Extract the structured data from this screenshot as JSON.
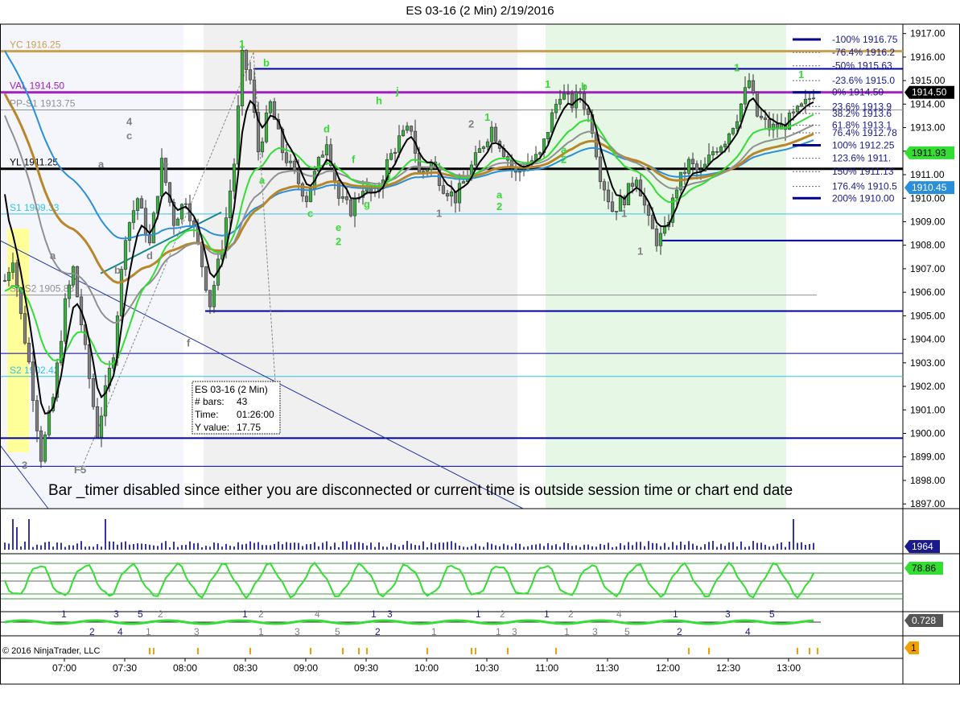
{
  "window": {
    "title": "ES 03-16 (2 Min)  2/19/2016"
  },
  "colors": {
    "up_bar": "#3cb043",
    "down_bar": "#808080",
    "ema_fast": "#000000",
    "ema_green": "#33dd33",
    "sma_brown": "#b8862b",
    "sma_blue": "#2a8fd8",
    "sma_gray": "#909090",
    "level_blue": "#0000a0",
    "level_cyan": "#33c4e6",
    "level_purple": "#a020c0",
    "level_gold": "#c8a050",
    "session_gray": "#f0f0f0",
    "session_green": "#e6f7e6",
    "opening_yellow": "#ffff99"
  },
  "chart_data": {
    "type": "candlestick",
    "instrument": "ES 03-16",
    "interval": "2 Min",
    "date": "2/19/2016",
    "y_range": [
      1896.8,
      1917.4
    ],
    "y_ticks": [
      "1917.00",
      "1916.00",
      "1915.00",
      "1914.00",
      "1913.00",
      "1912.00",
      "1911.00",
      "1910.00",
      "1909.00",
      "1908.00",
      "1907.00",
      "1906.00",
      "1905.00",
      "1904.00",
      "1903.00",
      "1902.00",
      "1901.00",
      "1900.00",
      "1899.00",
      "1898.00",
      "1897.00"
    ],
    "x_ticks": [
      "07:00",
      "07:30",
      "08:00",
      "08:30",
      "09:00",
      "09:30",
      "10:00",
      "10:30",
      "11:00",
      "11:30",
      "12:00",
      "12:30",
      "13:00"
    ],
    "price_path": [
      [
        0,
        1906.5
      ],
      [
        2,
        1907.5
      ],
      [
        4,
        1905.0
      ],
      [
        6,
        1903.0
      ],
      [
        9,
        1899.0
      ],
      [
        12,
        1901.5
      ],
      [
        15,
        1905.5
      ],
      [
        17,
        1907.0
      ],
      [
        20,
        1903.5
      ],
      [
        23,
        1900.0
      ],
      [
        27,
        1903.5
      ],
      [
        30,
        1908.5
      ],
      [
        33,
        1910.0
      ],
      [
        36,
        1908.0
      ],
      [
        39,
        1911.5
      ],
      [
        42,
        1909.0
      ],
      [
        45,
        1910.0
      ],
      [
        48,
        1908.0
      ],
      [
        51,
        1905.5
      ],
      [
        54,
        1908.0
      ],
      [
        57,
        1911.5
      ],
      [
        59,
        1916.0
      ],
      [
        61,
        1915.0
      ],
      [
        63,
        1912.0
      ],
      [
        66,
        1914.0
      ],
      [
        69,
        1912.0
      ],
      [
        72,
        1911.0
      ],
      [
        75,
        1910.0
      ],
      [
        78,
        1911.5
      ],
      [
        80,
        1912.5
      ],
      [
        83,
        1910.0
      ],
      [
        86,
        1909.5
      ],
      [
        89,
        1910.5
      ],
      [
        92,
        1910.0
      ],
      [
        95,
        1911.5
      ],
      [
        98,
        1912.5
      ],
      [
        101,
        1913.0
      ],
      [
        103,
        1911.0
      ],
      [
        106,
        1911.5
      ],
      [
        109,
        1910.5
      ],
      [
        112,
        1910.0
      ],
      [
        115,
        1911.0
      ],
      [
        118,
        1912.0
      ],
      [
        121,
        1913.0
      ],
      [
        124,
        1912.0
      ],
      [
        127,
        1911.0
      ],
      [
        130,
        1911.5
      ],
      [
        133,
        1911.8
      ],
      [
        136,
        1913.5
      ],
      [
        138,
        1914.5
      ],
      [
        141,
        1914.0
      ],
      [
        143,
        1914.5
      ],
      [
        146,
        1913.0
      ],
      [
        148,
        1911.0
      ],
      [
        151,
        1909.5
      ],
      [
        154,
        1910.0
      ],
      [
        157,
        1911.0
      ],
      [
        160,
        1909.0
      ],
      [
        162,
        1908.2
      ],
      [
        164,
        1908.5
      ],
      [
        167,
        1910.5
      ],
      [
        170,
        1911.5
      ],
      [
        173,
        1911.0
      ],
      [
        176,
        1912.0
      ],
      [
        179,
        1912.5
      ],
      [
        182,
        1913.5
      ],
      [
        185,
        1915.0
      ],
      [
        187,
        1913.5
      ],
      [
        190,
        1913.0
      ],
      [
        193,
        1913.0
      ],
      [
        196,
        1913.5
      ],
      [
        199,
        1914.0
      ],
      [
        201,
        1914.5
      ]
    ],
    "levels": [
      {
        "label": "YC 1916.25",
        "price": 1916.25,
        "color": "#c8a050"
      },
      {
        "label": "VAL 1914.50",
        "price": 1914.5,
        "color": "#a020c0"
      },
      {
        "label": "PP-S1 1913.75",
        "price": 1913.75,
        "color": "#909090"
      },
      {
        "label": "YL 1911.25",
        "price": 1911.25,
        "color": "#000000"
      },
      {
        "label": "S1 1909.33",
        "price": 1909.33,
        "color": "#33c4e6"
      },
      {
        "label": "S1-S2 1905.88",
        "price": 1905.88,
        "color": "#909090"
      },
      {
        "label": "S2 1902.42",
        "price": 1902.42,
        "color": "#33c4e6"
      }
    ],
    "horizontal_lines": [
      1915.5,
      1905.2,
      1903.4,
      1899.8,
      1898.6,
      1908.2
    ],
    "fib_levels": [
      {
        "label": "-100%",
        "value": "1916.75",
        "price": 1916.75
      },
      {
        "label": "-76.4%",
        "value": "1916.2",
        "price": 1916.2
      },
      {
        "label": "-50%",
        "value": "1915.63",
        "price": 1915.63
      },
      {
        "label": "-23.6%",
        "value": "1915.0",
        "price": 1915.0
      },
      {
        "label": "0%",
        "value": "1914.50",
        "price": 1914.5
      },
      {
        "label": "23.6%",
        "value": "1913.9",
        "price": 1913.9
      },
      {
        "label": "38.2%",
        "value": "1913.6",
        "price": 1913.6
      },
      {
        "label": "61.8%",
        "value": "1913.1",
        "price": 1913.1
      },
      {
        "label": "76.4%",
        "value": "1912.78",
        "price": 1912.78
      },
      {
        "label": "100%",
        "value": "1912.25",
        "price": 1912.25
      },
      {
        "label": "123.6%",
        "value": "1911.",
        "price": 1911.7
      },
      {
        "label": "150%",
        "value": "1911.13",
        "price": 1911.13
      },
      {
        "label": "176.4%",
        "value": "1910.5",
        "price": 1910.5
      },
      {
        "label": "200%",
        "value": "1910.00",
        "price": 1910.0
      }
    ],
    "price_tags": [
      {
        "label": "1914.50",
        "price": 1914.5,
        "bg": "#000000",
        "fg": "#ffffff"
      },
      {
        "label": "1911.93",
        "price": 1911.93,
        "bg": "#33dd33",
        "fg": "#000000"
      },
      {
        "label": "1910.45",
        "price": 1910.45,
        "bg": "#2a8fd8",
        "fg": "#ffffff"
      }
    ],
    "annotations": [
      {
        "text": "1",
        "bar": 59,
        "price": 1916.4,
        "color": "#33dd33"
      },
      {
        "text": "b",
        "bar": 65,
        "price": 1915.6,
        "color": "#33dd33"
      },
      {
        "text": "a",
        "bar": 64,
        "price": 1910.6,
        "color": "#33dd33"
      },
      {
        "text": "d",
        "bar": 80,
        "price": 1912.8,
        "color": "#33dd33"
      },
      {
        "text": "c",
        "bar": 76,
        "price": 1909.2,
        "color": "#33dd33"
      },
      {
        "text": "f",
        "bar": 87,
        "price": 1911.5,
        "color": "#33dd33"
      },
      {
        "text": "h",
        "bar": 93,
        "price": 1914.0,
        "color": "#33dd33"
      },
      {
        "text": "j",
        "bar": 98,
        "price": 1914.4,
        "color": "#33dd33"
      },
      {
        "text": "g",
        "bar": 90,
        "price": 1909.6,
        "color": "#33dd33"
      },
      {
        "text": "i",
        "bar": 96,
        "price": 1910.8,
        "color": "#33dd33"
      },
      {
        "text": "e",
        "bar": 83,
        "price": 1908.6,
        "color": "#33dd33"
      },
      {
        "text": "2",
        "bar": 83,
        "price": 1908.0,
        "color": "#33dd33"
      },
      {
        "text": "2",
        "bar": 116,
        "price": 1913.0,
        "color": "#808080"
      },
      {
        "text": "1",
        "bar": 120,
        "price": 1913.3,
        "color": "#33dd33"
      },
      {
        "text": "1",
        "bar": 108,
        "price": 1909.2,
        "color": "#808080"
      },
      {
        "text": "a",
        "bar": 123,
        "price": 1910.0,
        "color": "#33dd33"
      },
      {
        "text": "2",
        "bar": 123,
        "price": 1909.5,
        "color": "#33dd33"
      },
      {
        "text": "1",
        "bar": 135,
        "price": 1914.7,
        "color": "#33dd33"
      },
      {
        "text": "b",
        "bar": 144,
        "price": 1914.6,
        "color": "#33dd33"
      },
      {
        "text": "a",
        "bar": 139,
        "price": 1911.9,
        "color": "#33dd33"
      },
      {
        "text": "2",
        "bar": 139,
        "price": 1911.5,
        "color": "#33dd33"
      },
      {
        "text": "1",
        "bar": 154,
        "price": 1909.2,
        "color": "#808080"
      },
      {
        "text": "1",
        "bar": 158,
        "price": 1907.6,
        "color": "#808080"
      },
      {
        "text": "1",
        "bar": 182,
        "price": 1915.4,
        "color": "#33dd33"
      },
      {
        "text": "1",
        "bar": 198,
        "price": 1915.1,
        "color": "#33dd33"
      },
      {
        "text": "a",
        "bar": 24,
        "price": 1911.3,
        "color": "#808080"
      },
      {
        "text": "4",
        "bar": 31,
        "price": 1913.1,
        "color": "#808080"
      },
      {
        "text": "c",
        "bar": 31,
        "price": 1912.5,
        "color": "#808080"
      },
      {
        "text": "e",
        "bar": 40,
        "price": 1911.3,
        "color": "#808080"
      },
      {
        "text": "a",
        "bar": 12,
        "price": 1907.4,
        "color": "#808080"
      },
      {
        "text": "b",
        "bar": 28,
        "price": 1906.8,
        "color": "#808080"
      },
      {
        "text": "d",
        "bar": 36,
        "price": 1907.4,
        "color": "#808080"
      },
      {
        "text": "f",
        "bar": 46,
        "price": 1903.7,
        "color": "#808080"
      },
      {
        "text": "3",
        "bar": 5,
        "price": 1898.5,
        "color": "#808080"
      },
      {
        "text": "F5",
        "bar": 18,
        "price": 1898.3,
        "color": "#808080"
      }
    ],
    "info_box": {
      "line1": "ES 03-16 (2 Min)",
      "bars_label": "# bars:",
      "bars_value": "43",
      "time_label": "Time:",
      "time_value": "01:26:00",
      "y_label": "Y value:",
      "y_value": "17.75"
    },
    "message": "Bar _timer disabled since either you are disconnected or current time is outside session time or chart end date",
    "volume_tag": "1964",
    "osc_tag": "78.86",
    "osc2_tag": "0.728",
    "osc3_tag": "1",
    "wave_labels_low": [
      {
        "text": "1",
        "bar": 14,
        "row": 0,
        "color": "#1a1a8c"
      },
      {
        "text": "2",
        "bar": 21,
        "row": 1,
        "color": "#1a1a8c"
      },
      {
        "text": "3",
        "bar": 27,
        "row": 0,
        "color": "#1a1a8c"
      },
      {
        "text": "4",
        "bar": 28,
        "row": 1,
        "color": "#1a1a8c"
      },
      {
        "text": "5",
        "bar": 33,
        "row": 0,
        "color": "#1a1a8c"
      },
      {
        "text": "1",
        "bar": 35,
        "row": 1,
        "color": "#808080"
      },
      {
        "text": "2",
        "bar": 38,
        "row": 0,
        "color": "#808080"
      },
      {
        "text": "3",
        "bar": 47,
        "row": 1,
        "color": "#808080"
      },
      {
        "text": "1",
        "bar": 59,
        "row": 0,
        "color": "#1a1a8c"
      },
      {
        "text": "2",
        "bar": 63,
        "row": 0,
        "color": "#808080"
      },
      {
        "text": "1",
        "bar": 63,
        "row": 1,
        "color": "#808080"
      },
      {
        "text": "3",
        "bar": 72,
        "row": 1,
        "color": "#808080"
      },
      {
        "text": "4",
        "bar": 77,
        "row": 0,
        "color": "#808080"
      },
      {
        "text": "5",
        "bar": 82,
        "row": 1,
        "color": "#808080"
      },
      {
        "text": "1",
        "bar": 91,
        "row": 0,
        "color": "#1a1a8c"
      },
      {
        "text": "2",
        "bar": 92,
        "row": 1,
        "color": "#1a1a8c"
      },
      {
        "text": "3",
        "bar": 95,
        "row": 0,
        "color": "#1a1a8c"
      },
      {
        "text": "1",
        "bar": 106,
        "row": 1,
        "color": "#808080"
      },
      {
        "text": "1",
        "bar": 117,
        "row": 0,
        "color": "#1a1a8c"
      },
      {
        "text": "2",
        "bar": 123,
        "row": 0,
        "color": "#808080"
      },
      {
        "text": "1",
        "bar": 122,
        "row": 1,
        "color": "#808080"
      },
      {
        "text": "3",
        "bar": 126,
        "row": 1,
        "color": "#808080"
      },
      {
        "text": "1",
        "bar": 134,
        "row": 0,
        "color": "#1a1a8c"
      },
      {
        "text": "2",
        "bar": 140,
        "row": 0,
        "color": "#808080"
      },
      {
        "text": "1",
        "bar": 139,
        "row": 1,
        "color": "#808080"
      },
      {
        "text": "3",
        "bar": 146,
        "row": 1,
        "color": "#808080"
      },
      {
        "text": "4",
        "bar": 152,
        "row": 0,
        "color": "#808080"
      },
      {
        "text": "5",
        "bar": 154,
        "row": 1,
        "color": "#808080"
      },
      {
        "text": "1",
        "bar": 166,
        "row": 0,
        "color": "#1a1a8c"
      },
      {
        "text": "2",
        "bar": 167,
        "row": 1,
        "color": "#1a1a8c"
      },
      {
        "text": "3",
        "bar": 179,
        "row": 0,
        "color": "#1a1a8c"
      },
      {
        "text": "4",
        "bar": 184,
        "row": 1,
        "color": "#1a1a8c"
      },
      {
        "text": "5",
        "bar": 190,
        "row": 0,
        "color": "#1a1a8c"
      }
    ],
    "copyright": "© 2016 NinjaTrader, LLC"
  }
}
